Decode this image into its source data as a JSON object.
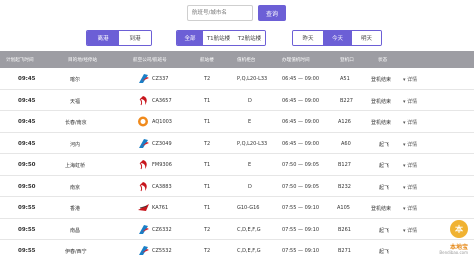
{
  "search": {
    "placeholder": "航班号/城市名",
    "button_label": "查询"
  },
  "filters": {
    "direction": [
      "离港",
      "到港"
    ],
    "direction_selected": 0,
    "terminal": [
      "全部",
      "T1航站楼",
      "T2航站楼"
    ],
    "terminal_selected": 0,
    "day": [
      "昨天",
      "今天",
      "明天"
    ],
    "day_selected": 1
  },
  "columns": [
    "计划起飞时间",
    "目的地/经停站",
    "航空公司/航班号",
    "航站楼",
    "值机柜台",
    "办理值机时间",
    "登机口",
    "状态",
    ""
  ],
  "rows": [
    {
      "time": "09:45",
      "dest": "喀尔",
      "airline_icon": "china-southern-logo",
      "flight": "CZ337",
      "term": "T2",
      "counter": "P,Q,L20-L33",
      "checkin": "06:45 — 09:00",
      "gate": "A51",
      "status": "登机结束",
      "detail": "详情"
    },
    {
      "time": "09:45",
      "dest": "天福",
      "airline_icon": "air-china-logo",
      "flight": "CA3657",
      "term": "T1",
      "counter": "D",
      "checkin": "06:45 — 09:00",
      "gate": "B227",
      "status": "登机结束",
      "detail": "详情"
    },
    {
      "time": "09:45",
      "dest": "长春/南京",
      "airline_icon": "shenzhen-airlines-logo",
      "flight": "AQ1003",
      "term": "T1",
      "counter": "E",
      "checkin": "06:45 — 09:00",
      "gate": "A126",
      "status": "登机结束",
      "detail": "详情"
    },
    {
      "time": "09:45",
      "dest": "河内",
      "airline_icon": "china-southern-logo",
      "flight": "CZ3049",
      "term": "T2",
      "counter": "P,Q,L20-L33",
      "checkin": "06:45 — 09:00",
      "gate": "A60",
      "status": "起飞",
      "detail": "详情"
    },
    {
      "time": "09:50",
      "dest": "上海虹桥",
      "airline_icon": "air-china-logo",
      "flight": "FM9306",
      "term": "T1",
      "counter": "E",
      "checkin": "07:50 — 09:05",
      "gate": "B127",
      "status": "起飞",
      "detail": "详情"
    },
    {
      "time": "09:50",
      "dest": "南京",
      "airline_icon": "air-china-logo",
      "flight": "CA3883",
      "term": "T1",
      "counter": "D",
      "checkin": "07:50 — 09:05",
      "gate": "B232",
      "status": "起飞",
      "detail": "详情"
    },
    {
      "time": "09:55",
      "dest": "香港",
      "airline_icon": "korean-air-logo",
      "flight": "KA761",
      "term": "T1",
      "counter": "G10-G16",
      "checkin": "07:55 — 09:10",
      "gate": "A105",
      "status": "登机结束",
      "detail": "详情"
    },
    {
      "time": "09:55",
      "dest": "南昌",
      "airline_icon": "china-southern-logo",
      "flight": "CZ6332",
      "term": "T2",
      "counter": "C,D,E,F,G",
      "checkin": "07:55 — 09:10",
      "gate": "B261",
      "status": "起飞",
      "detail": "详情"
    },
    {
      "time": "09:55",
      "dest": "伊春/西宁",
      "airline_icon": "china-southern-logo",
      "flight": "CZ5532",
      "term": "T2",
      "counter": "C,D,E,F,G",
      "checkin": "07:55 — 09:10",
      "gate": "B271",
      "status": "起飞",
      "detail": "详情"
    }
  ],
  "watermark": {
    "brand": "本地宝",
    "url": "Bendibao.com"
  },
  "colors": {
    "accent": "#6c5fd6",
    "header_bg": "#9d9da3"
  }
}
